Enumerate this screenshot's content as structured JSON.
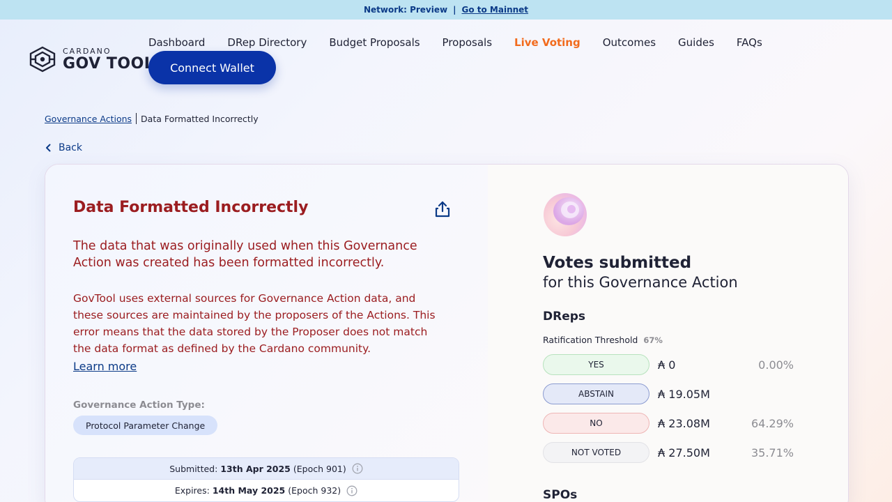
{
  "banner": {
    "network_label": "Network: Preview",
    "separator": "|",
    "mainnet_link": "Go to Mainnet"
  },
  "logo": {
    "small": "CARDANO",
    "big": "GOV TOOL"
  },
  "nav": {
    "items": [
      {
        "label": "Dashboard",
        "active": false
      },
      {
        "label": "DRep Directory",
        "active": false
      },
      {
        "label": "Budget Proposals",
        "active": false
      },
      {
        "label": "Proposals",
        "active": false
      },
      {
        "label": "Live Voting",
        "active": true
      },
      {
        "label": "Outcomes",
        "active": false
      },
      {
        "label": "Guides",
        "active": false
      },
      {
        "label": "FAQs",
        "active": false
      }
    ],
    "connect_wallet": "Connect Wallet",
    "active_color": "#f26b1d"
  },
  "breadcrumb": {
    "parent": "Governance Actions",
    "current": "Data Formatted Incorrectly"
  },
  "back_label": "Back",
  "action": {
    "title": "Data Formatted Incorrectly",
    "error_heading": "The data that was originally used when this Governance Action was created has been formatted incorrectly.",
    "error_body": "GovTool uses external sources for Governance Action data, and these sources are maintained by the proposers of the Actions. This error means that the data stored by the Proposer does not match the data format as defined by the Cardano community.",
    "learn_more": "Learn more",
    "type_label": "Governance Action Type:",
    "type_value": "Protocol Parameter Change",
    "submitted_label": "Submitted:",
    "submitted_date": "13th Apr 2025",
    "submitted_epoch": "(Epoch 901)",
    "expires_label": "Expires:",
    "expires_date": "14th May 2025",
    "expires_epoch": "(Epoch 932)",
    "error_color": "#9b1d20"
  },
  "votes": {
    "title": "Votes submitted",
    "subtitle": "for this Governance Action",
    "dreps_label": "DReps",
    "threshold_label": "Ratification Threshold",
    "threshold_value": "67%",
    "rows": [
      {
        "label": "YES",
        "amount": "₳ 0",
        "pct": "0.00%",
        "bg": "#eaf8ec",
        "border": "#b7e2bd"
      },
      {
        "label": "ABSTAIN",
        "amount": "₳ 19.05M",
        "pct": "",
        "bg": "#e4e9f8",
        "border": "#8b9bd0"
      },
      {
        "label": "NO",
        "amount": "₳ 23.08M",
        "pct": "64.29%",
        "bg": "#fbe9e9",
        "border": "#eeb5b5"
      },
      {
        "label": "NOT VOTED",
        "amount": "₳ 27.50M",
        "pct": "35.71%",
        "bg": "#f3f3f5",
        "border": "#e2e2e6"
      }
    ],
    "spos_label": "SPOs"
  }
}
